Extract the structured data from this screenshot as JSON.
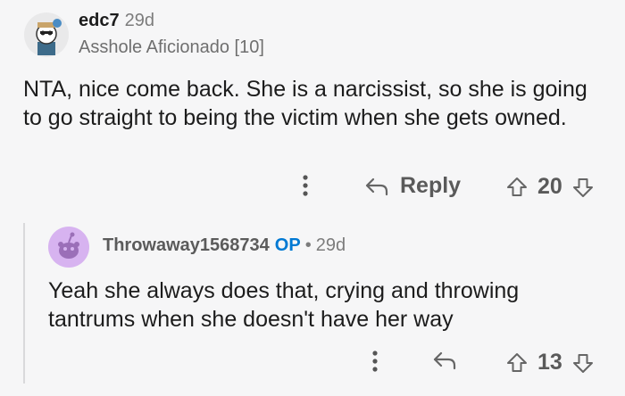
{
  "comment1": {
    "username": "edc7",
    "age": "29d",
    "flair": "Asshole Aficionado [10]",
    "body": "NTA, nice come back. She is a narcissist, so she is going to go straight to being the victim when she gets owned.",
    "reply_label": "Reply",
    "score": "20"
  },
  "comment2": {
    "username": "Throwaway1568734",
    "op_badge": "OP",
    "separator": "•",
    "age": "29d",
    "body": "Yeah she always does that, crying and throwing tantrums when she doesn't have her way",
    "score": "13"
  },
  "icons": {
    "more": "more-vertical-icon",
    "reply": "reply-arrow-icon",
    "upvote": "upvote-arrow-icon",
    "downvote": "downvote-arrow-icon"
  },
  "colors": {
    "background": "#f6f6f7",
    "op_badge": "#0079d3",
    "avatar2_bg": "#d7b3f0"
  }
}
